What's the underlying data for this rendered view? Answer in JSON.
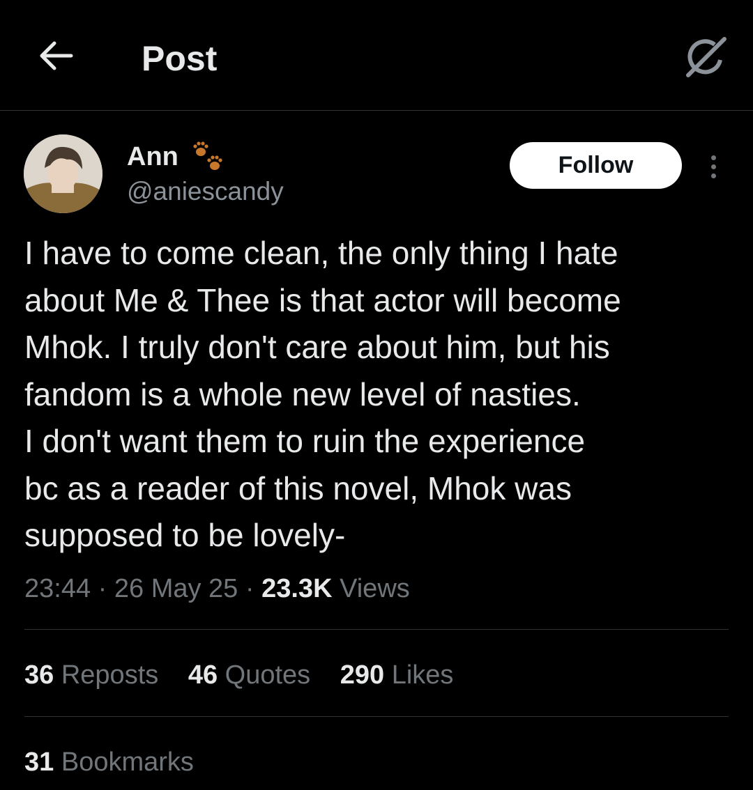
{
  "header": {
    "title": "Post",
    "back_icon": "arrow-left-icon",
    "grok_icon": "grok-icon"
  },
  "author": {
    "name": "Ann",
    "name_emoji": "paw-prints-icon",
    "handle": "@aniescandy",
    "follow_label": "Follow"
  },
  "post": {
    "text": "I have to come clean, the only thing I hate\nabout Me & Thee is that actor will become\nMhok. I truly don't care about him, but his\nfandom is a whole new level of nasties.\nI don't want them to ruin the experience\nbc as a reader of this novel, Mhok was\nsupposed to be lovely-",
    "time": "23:44",
    "date": "26 May 25",
    "separator": "·",
    "views_count": "23.3K",
    "views_label": "Views"
  },
  "stats": {
    "reposts": {
      "count": "36",
      "label": "Reposts"
    },
    "quotes": {
      "count": "46",
      "label": "Quotes"
    },
    "likes": {
      "count": "290",
      "label": "Likes"
    },
    "bookmarks": {
      "count": "31",
      "label": "Bookmarks"
    }
  },
  "colors": {
    "background": "#000000",
    "text": "#e7e9ea",
    "muted": "#71767b",
    "divider": "#2f3336",
    "follow_bg": "#ffffff"
  }
}
